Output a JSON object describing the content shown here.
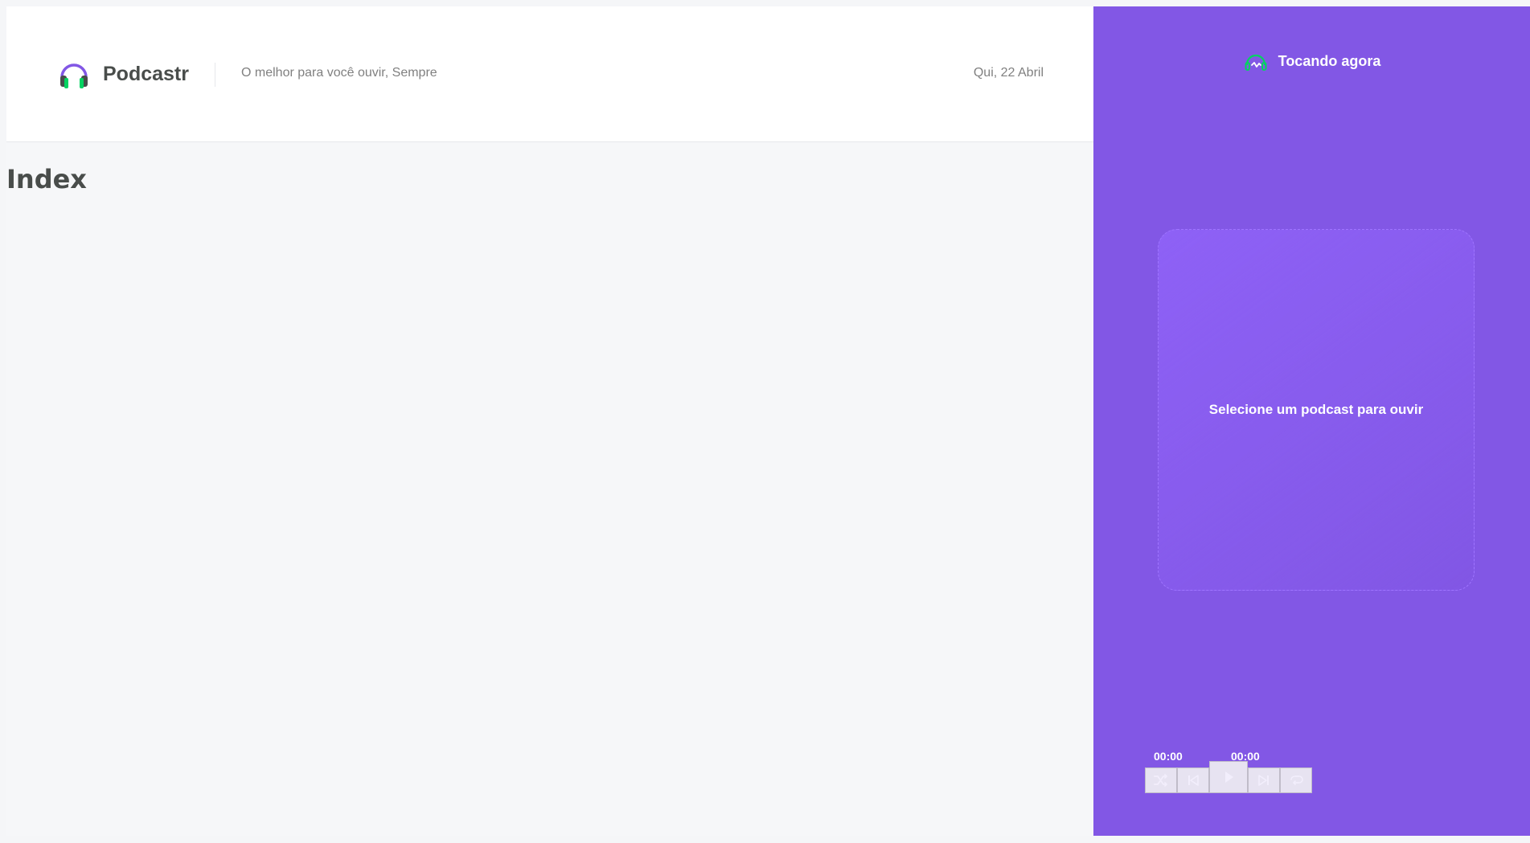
{
  "header": {
    "brand": "Podcastr",
    "tagline": "O melhor para você ouvir, Sempre",
    "date": "Qui, 22 Abril"
  },
  "main": {
    "title": "Index"
  },
  "player": {
    "now_playing_label": "Tocando agora",
    "empty_message": "Selecione um podcast para ouvir",
    "current_time": "00:00",
    "duration": "00:00",
    "controls": [
      "shuffle-icon",
      "previous-icon",
      "play-icon",
      "next-icon",
      "repeat-icon"
    ]
  },
  "colors": {
    "accent": "#8257e5",
    "green": "#04d361",
    "text_dark": "#494d4b",
    "text_muted": "#808080"
  }
}
